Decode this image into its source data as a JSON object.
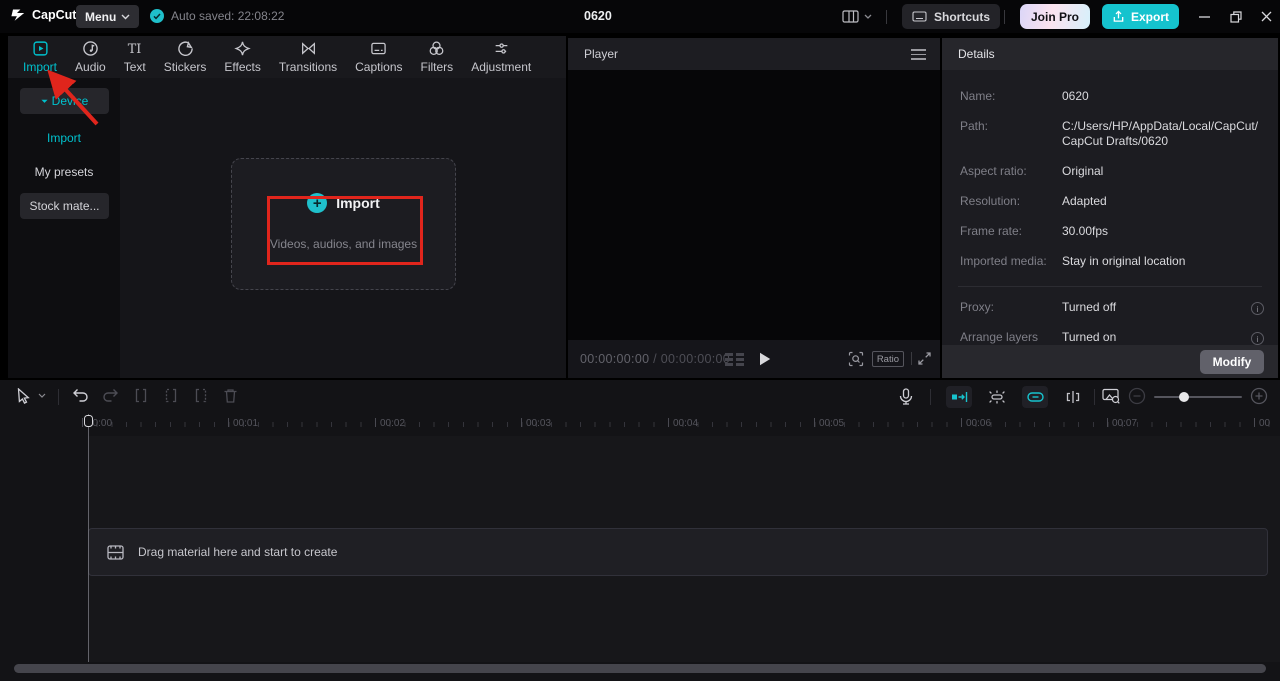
{
  "accent": "#00c1cd",
  "titlebar": {
    "app_name": "CapCut",
    "menu_label": "Menu",
    "autosave_text": "Auto saved: 22:08:22",
    "project_title": "0620",
    "shortcuts_label": "Shortcuts",
    "join_pro_label": "Join Pro",
    "export_label": "Export"
  },
  "media_panel": {
    "tabs": [
      {
        "label": "Import",
        "active": true
      },
      {
        "label": "Audio"
      },
      {
        "label": "Text"
      },
      {
        "label": "Stickers"
      },
      {
        "label": "Effects"
      },
      {
        "label": "Transitions"
      },
      {
        "label": "Captions"
      },
      {
        "label": "Filters"
      },
      {
        "label": "Adjustment"
      }
    ],
    "sidebar": {
      "device_label": "Device",
      "import_label": "Import",
      "presets_label": "My presets",
      "stock_label": "Stock mate..."
    },
    "dropzone": {
      "title": "Import",
      "subtitle": "Videos, audios, and images"
    }
  },
  "player": {
    "title": "Player",
    "current_time": "00:00:00:00",
    "time_separator": "/",
    "total_time": "00:00:00:00",
    "ratio_label": "Ratio"
  },
  "details": {
    "title": "Details",
    "rows": [
      {
        "label": "Name:",
        "value": "0620"
      },
      {
        "label": "Path:",
        "value": "C:/Users/HP/AppData/Local/CapCut/CapCut Drafts/0620"
      },
      {
        "label": "Aspect ratio:",
        "value": "Original"
      },
      {
        "label": "Resolution:",
        "value": "Adapted"
      },
      {
        "label": "Frame rate:",
        "value": "30.00fps"
      },
      {
        "label": "Imported media:",
        "value": "Stay in original location"
      },
      {
        "label": "Proxy:",
        "value": "Turned off"
      },
      {
        "label": "Arrange layers",
        "value": "Turned on"
      }
    ],
    "modify_label": "Modify"
  },
  "timeline": {
    "ruler_labels": [
      "00:00",
      "00:01",
      "00:02",
      "00:03",
      "00:04",
      "00:05",
      "00:06",
      "00:07",
      "00"
    ],
    "empty_text": "Drag material here and start to create"
  }
}
